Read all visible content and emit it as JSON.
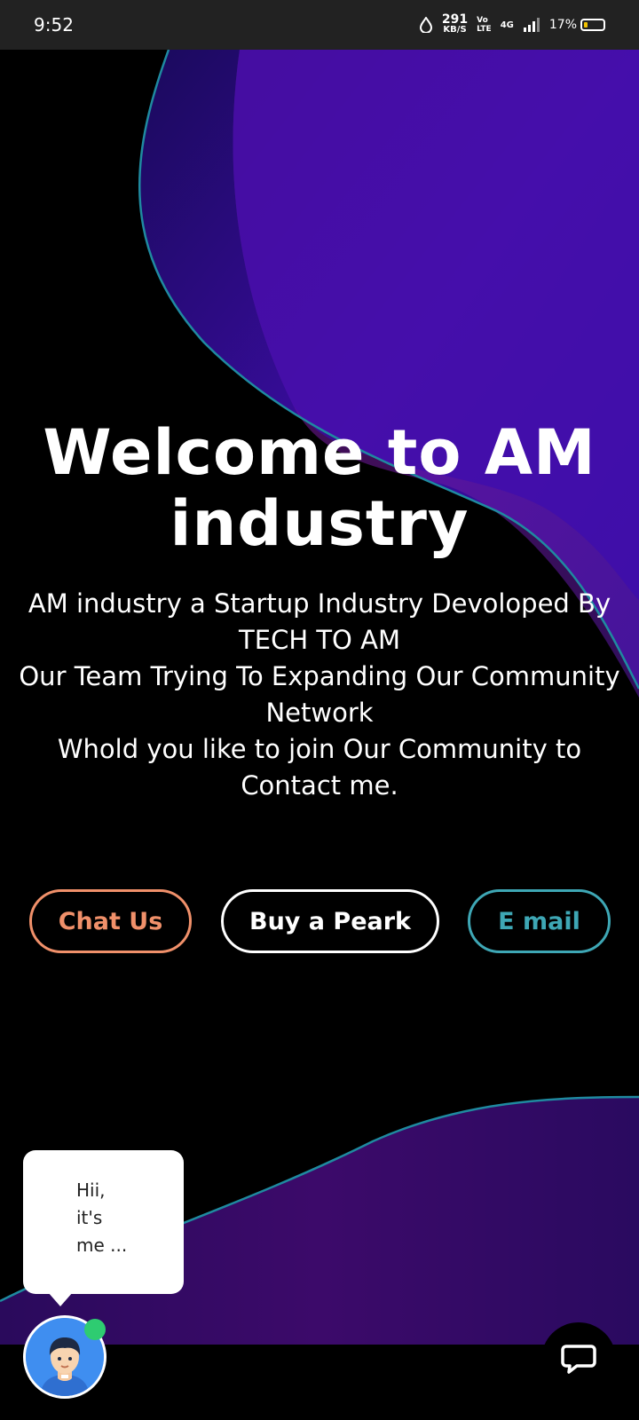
{
  "status_bar": {
    "time": "9:52",
    "net_speed_value": "291",
    "net_speed_unit": "KB/S",
    "volte_top": "Vo",
    "volte_bottom": "LTE",
    "signal": "4G",
    "battery_percent": "17%",
    "battery_level": 0.17
  },
  "hero": {
    "title": "Welcome to AM industry",
    "lines": [
      "AM industry a Startup Industry Devoloped By TECH TO AM",
      "Our Team Trying To Expanding Our Community Network",
      "Whold you like to join Our Community to Contact me."
    ]
  },
  "buttons": {
    "chat_label": "Chat Us",
    "buy_label": "Buy a Peark",
    "email_label": "E mail"
  },
  "chat_widget": {
    "bubble_lines": [
      "Hii,",
      "it's",
      "me ..."
    ],
    "avatar_icon": "person-avatar-icon",
    "status": "online",
    "launcher_icon": "chat-bubble-icon"
  },
  "colors": {
    "chat_button": "#f0906a",
    "buy_button": "#ffffff",
    "email_button": "#3ea7b5",
    "wave_purple": "#4a0fb0",
    "wave_magenta": "#7a148f",
    "wave_outline": "#1f8aa0",
    "online": "#2ecc71"
  }
}
